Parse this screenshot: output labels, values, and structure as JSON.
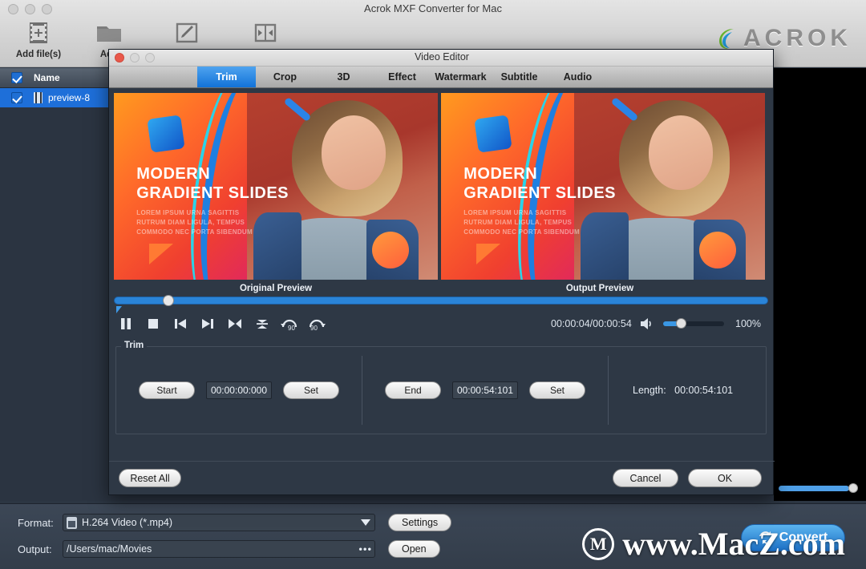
{
  "main_window": {
    "title": "Acrok MXF Converter for Mac",
    "brand": "ACROK",
    "toolbar": [
      {
        "label": "Add file(s)",
        "icon": "film-add-icon"
      },
      {
        "label": "Add",
        "icon": "folder-icon"
      },
      {
        "label": "",
        "icon": "edit-pencil-icon"
      },
      {
        "label": "",
        "icon": "merge-icon"
      }
    ],
    "file_list": {
      "header_name": "Name",
      "rows": [
        {
          "name": "preview-8",
          "checked": true,
          "selected": true
        }
      ]
    }
  },
  "dialog": {
    "title": "Video Editor",
    "tabs": [
      {
        "label": "Trim",
        "active": true
      },
      {
        "label": "Crop",
        "active": false
      },
      {
        "label": "3D",
        "active": false
      },
      {
        "label": "Effect",
        "active": false
      },
      {
        "label": "Watermark",
        "active": false
      },
      {
        "label": "Subtitle",
        "active": false
      },
      {
        "label": "Audio",
        "active": false
      }
    ],
    "preview": {
      "original_label": "Original Preview",
      "output_label": "Output Preview",
      "slide_title_line1": "MODERN",
      "slide_title_line2": "GRADIENT SLIDES",
      "slide_sub_line1": "LOREM IPSUM URNA SAGITTIS",
      "slide_sub_line2": "RUTRUM DIAM LIGULA, TEMPUS",
      "slide_sub_line3": "COMMODO NEC PORTA SIBENDUM"
    },
    "player": {
      "time": "00:00:04/00:00:54",
      "zoom": "100%",
      "controls": [
        {
          "name": "pause-button",
          "icon": "pause-icon"
        },
        {
          "name": "stop-button",
          "icon": "stop-icon"
        },
        {
          "name": "previous-frame-button",
          "icon": "previous-frame-icon"
        },
        {
          "name": "next-frame-button",
          "icon": "next-frame-icon"
        },
        {
          "name": "snapshot-button",
          "icon": "marker-icon"
        },
        {
          "name": "flip-vertical-button",
          "icon": "flip-vertical-icon"
        },
        {
          "name": "rotate-left-button",
          "icon": "rotate-left-90-icon"
        },
        {
          "name": "rotate-right-button",
          "icon": "rotate-right-90-icon"
        }
      ]
    },
    "trim": {
      "legend": "Trim",
      "start_label": "Start",
      "start_value": "00:00:00:000",
      "start_set": "Set",
      "end_label": "End",
      "end_value": "00:00:54:101",
      "end_set": "Set",
      "length_label": "Length:",
      "length_value": "00:00:54:101"
    },
    "footer": {
      "reset": "Reset All",
      "cancel": "Cancel",
      "ok": "OK"
    }
  },
  "bottom": {
    "format_label": "Format:",
    "format_value": "H.264 Video (*.mp4)",
    "settings_button": "Settings",
    "output_label": "Output:",
    "output_value": "/Users/mac/Movies",
    "open_button": "Open",
    "convert_button": "Convert",
    "watermark": "www.MacZ.com"
  },
  "colors": {
    "accent_blue": "#1272d8",
    "panel_dark": "#2e3845",
    "titlebar_gray": "#d4d4d4"
  }
}
